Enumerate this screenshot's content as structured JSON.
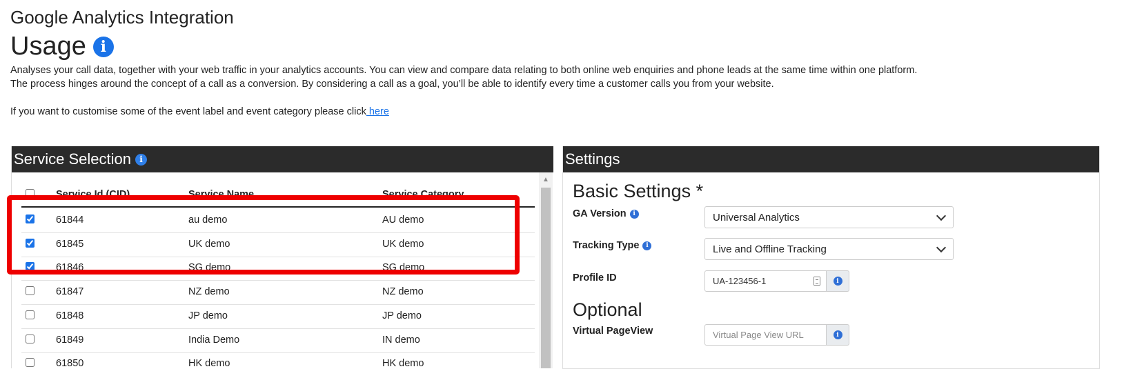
{
  "page": {
    "subtitle": "Google Analytics Integration",
    "title": "Usage",
    "info_icon": "info-icon",
    "desc_line1": "Analyses your call data, together with your web traffic in your analytics accounts. You can view and compare data relating to both online web enquiries and phone leads at the same time within one platform.",
    "desc_line2": "The process hinges around the concept of a call as a conversion. By considering a call as a goal, you’ll be able to identify every time a customer calls you from your website.",
    "customise_text": "If you want to customise some of the event label and event category please click",
    "customise_link": " here"
  },
  "service_selection": {
    "title": "Service Selection",
    "columns": [
      "Service Id (CID)",
      "Service Name",
      "Service Category"
    ],
    "rows": [
      {
        "id": "61844",
        "name": "au demo",
        "category": "AU demo",
        "checked": true
      },
      {
        "id": "61845",
        "name": "UK demo",
        "category": "UK demo",
        "checked": true
      },
      {
        "id": "61846",
        "name": "SG demo",
        "category": "SG demo",
        "checked": true
      },
      {
        "id": "61847",
        "name": "NZ demo",
        "category": "NZ demo",
        "checked": false
      },
      {
        "id": "61848",
        "name": "JP demo",
        "category": "JP demo",
        "checked": false
      },
      {
        "id": "61849",
        "name": "India Demo",
        "category": "IN demo",
        "checked": false
      },
      {
        "id": "61850",
        "name": "HK demo",
        "category": "HK demo",
        "checked": false
      }
    ]
  },
  "settings": {
    "title": "Settings",
    "basic_title": "Basic Settings *",
    "ga_version_label": "GA Version",
    "ga_version_value": "Universal Analytics",
    "tracking_type_label": "Tracking Type",
    "tracking_type_value": "Live and Offline Tracking",
    "profile_id_label": "Profile ID",
    "profile_id_value": "UA-123456-1",
    "optional_title": "Optional",
    "virtual_pageview_label": "Virtual PageView",
    "virtual_pageview_placeholder": "Virtual Page View URL"
  },
  "colors": {
    "header_bg": "#2b2b2b",
    "accent": "#1a73e8",
    "highlight": "#ee0000"
  }
}
